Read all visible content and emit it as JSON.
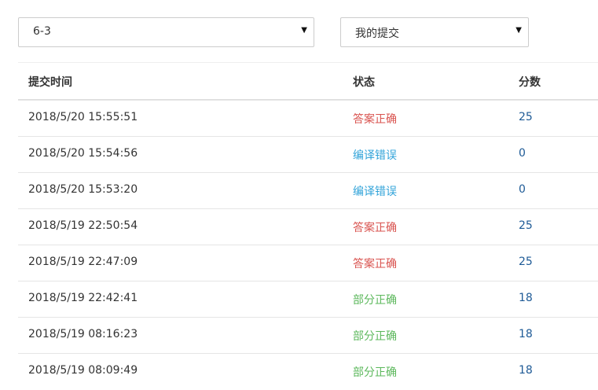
{
  "filters": {
    "problem": {
      "value": "6-3"
    },
    "scope": {
      "value": "我的提交"
    },
    "arrow_glyph": "▼"
  },
  "table": {
    "headers": {
      "time": "提交时间",
      "status": "状态",
      "score": "分数"
    },
    "rows": [
      {
        "time": "2018/5/20 15:55:51",
        "status": "答案正确",
        "score": "25",
        "status_type": "correct"
      },
      {
        "time": "2018/5/20 15:54:56",
        "status": "编译错误",
        "score": "0",
        "status_type": "compile"
      },
      {
        "time": "2018/5/20 15:53:20",
        "status": "编译错误",
        "score": "0",
        "status_type": "compile"
      },
      {
        "time": "2018/5/19 22:50:54",
        "status": "答案正确",
        "score": "25",
        "status_type": "correct"
      },
      {
        "time": "2018/5/19 22:47:09",
        "status": "答案正确",
        "score": "25",
        "status_type": "correct"
      },
      {
        "time": "2018/5/19 22:42:41",
        "status": "部分正确",
        "score": "18",
        "status_type": "partial"
      },
      {
        "time": "2018/5/19 08:16:23",
        "status": "部分正确",
        "score": "18",
        "status_type": "partial"
      },
      {
        "time": "2018/5/19 08:09:49",
        "status": "部分正确",
        "score": "18",
        "status_type": "partial"
      }
    ]
  },
  "colors": {
    "correct": "#d9534f",
    "compile": "#31a3d9",
    "partial": "#5cb85c",
    "score": "#1e5a96"
  }
}
